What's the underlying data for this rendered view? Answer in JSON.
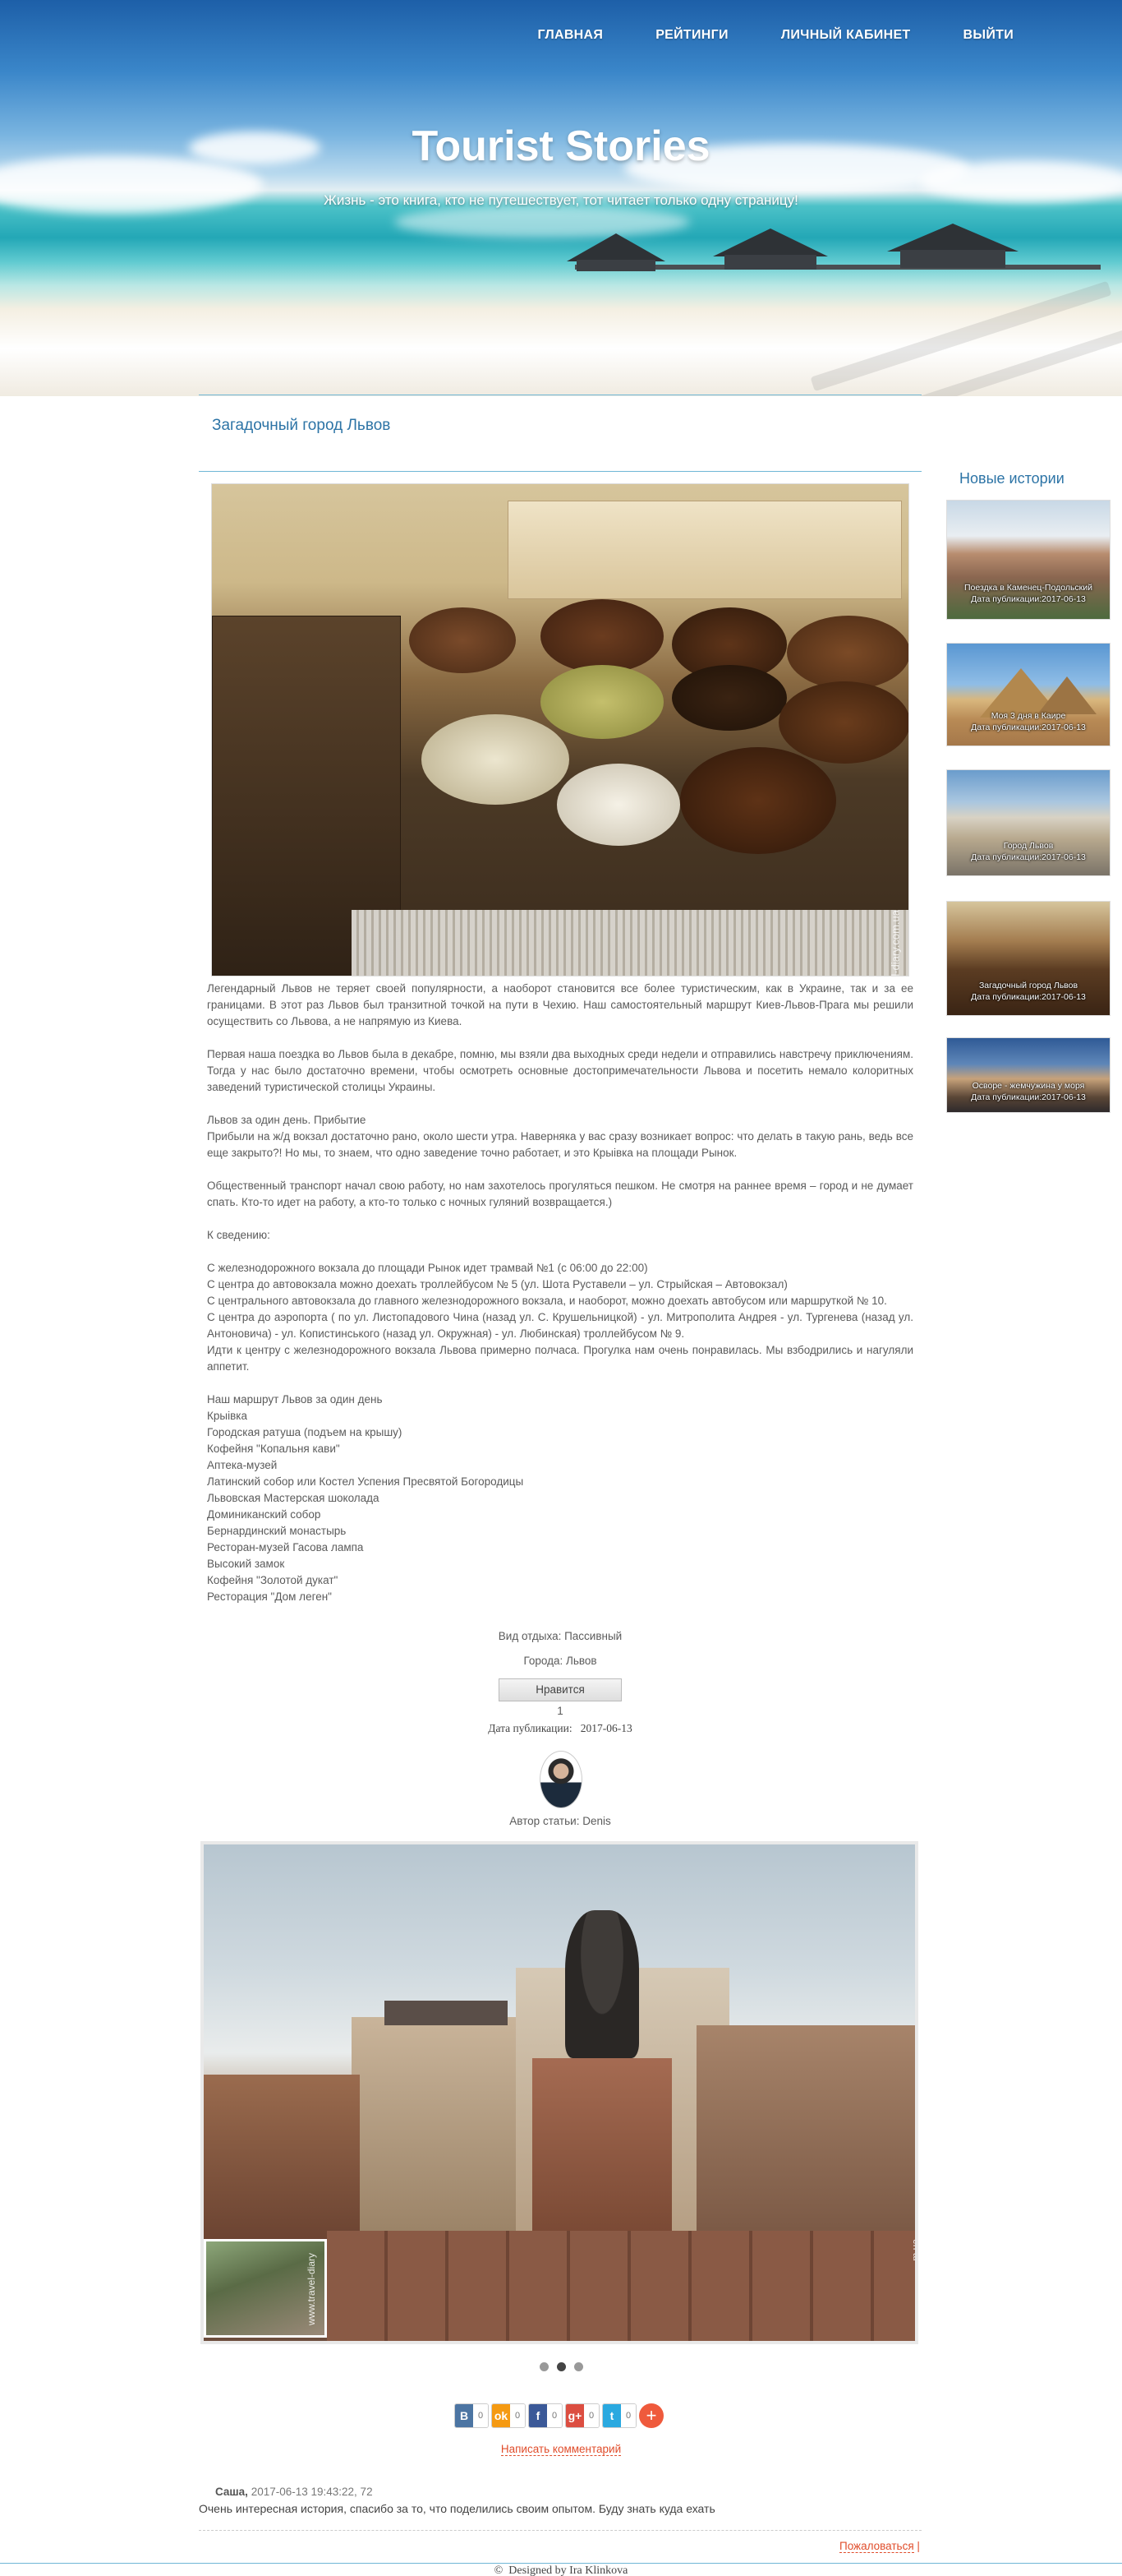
{
  "nav": {
    "items": [
      "ГЛАВНАЯ",
      "РЕЙТИНГИ",
      "ЛИЧНЫЙ КАБИНЕТ",
      "ВЫЙТИ"
    ]
  },
  "hero": {
    "title": "Tourist Stories",
    "tagline": "Жизнь - это книга, кто не путешествует, тот читает только одну страницу!"
  },
  "story": {
    "title": "Загадочный город Львов",
    "photo_watermark": "www.travel-diary.com.ua",
    "paragraphs": [
      "Легендарный Львов не теряет своей популярности, а наоборот становится все более туристическим, как в Украине, так и за ее границами. В этот раз Львов был транзитной точкой на пути в Чехию. Наш самостоятельный маршрут Киев-Львов-Прага мы решили осуществить со Львова, а не напрямую из Киева.",
      "",
      "Первая наша поездка во Львов была в декабре, помню, мы взяли два выходных среди недели и отправились навстречу приключениям. Тогда у нас было достаточно времени, чтобы осмотреть основные достопримечательности Львова и посетить немало колоритных заведений туристической столицы Украины.",
      "",
      "Львов за один день. Прибытие",
      "Прибыли на ж/д вокзал достаточно рано, около шести утра. Наверняка у вас сразу возникает вопрос: что делать в такую рань, ведь все еще закрыто?! Но мы, то знаем, что одно заведение точно работает, и это Крыівка на площади Рынок.",
      "",
      "Общественный транспорт начал свою работу, но нам захотелось прогуляться пешком. Не смотря на раннее время – город и не думает спать. Кто-то идет на работу, а кто-то только с ночных гуляний возвращается.)",
      "",
      "К сведению:",
      "",
      "С железнодорожного вокзала до площади Рынок идет трамвай №1 (с 06:00 до 22:00)",
      "С центра до автовокзала можно доехать троллейбусом № 5 (ул. Шота Руставели – ул. Стрыйская – Автовокзал)",
      "С центрального автовокзала до главного железнодорожного вокзала, и наоборот, можно доехать автобусом или маршруткой № 10.",
      "С центра до аэропорта ( по ул. Листопадового Чина (назад ул. С. Крушельницкой) - ул. Митрополита Андрея - ул. Тургенева (назад ул. Антоновича) - ул. Копистинського (назад ул. Окружная) - ул. Любинская) троллейбусом № 9.",
      "Идти к центру с железнодорожного вокзала Львова примерно полчаса. Прогулка нам очень понравилась. Мы взбодрились и нагуляли аппетит.",
      "",
      "Наш маршрут Львов за один день",
      "Крыівка",
      "Городская ратуша (подъем на крышу)",
      "Кофейня \"Копальня кави\"",
      "Аптека-музей",
      "Латинский собор или Костел Успения Пресвятой Богородицы",
      "Львовская Мастерская шоколада",
      "Доминиканский собор",
      "Бернардинский монастырь",
      "Ресторан-музей Гасова лампа",
      "Высокий замок",
      "Кофейня \"Золотой дукат\"",
      "Ресторация \"Дом леген\""
    ],
    "rest_type": "Вид отдыха: Пассивный",
    "city": "Города: Львов",
    "like_button": "Нравится",
    "like_count": "1",
    "date_label": "Дата публикации:",
    "date_value": "2017-06-13",
    "author": "Автор статьи: Denis"
  },
  "slider": {
    "watermark_left": "www.travel-diary",
    "watermark_right": "m.ua",
    "dots": 3,
    "active_dot": 1
  },
  "share": {
    "buttons": [
      {
        "icon": "В",
        "count": "0",
        "color": "#4c75a3"
      },
      {
        "icon": "ok",
        "count": "0",
        "color": "#f59a12"
      },
      {
        "icon": "f",
        "count": "0",
        "color": "#3b5998"
      },
      {
        "icon": "g+",
        "count": "0",
        "color": "#dc4e41"
      },
      {
        "icon": "t",
        "count": "0",
        "color": "#2aa9e0"
      }
    ],
    "more": "+"
  },
  "comments": {
    "write_link": "Написать комментарий",
    "items": [
      {
        "author": "Саша,",
        "meta": "2017-06-13 19:43:22, 72",
        "text": "Очень интересная история, спасибо за то, что поделились своим опытом. Буду знать куда ехать"
      }
    ],
    "complain_link": "Пожаловаться"
  },
  "footer": {
    "text": "Designed by Ira Klinkova"
  },
  "sidebar": {
    "title": "Новые истории",
    "stories": [
      {
        "title": "Поездка в Каменец-Подольский",
        "date": "Дата публикации:2017-06-13"
      },
      {
        "title": "Моя 3 дня в Каире",
        "date": "Дата публикации:2017-06-13"
      },
      {
        "title": "Город Львов",
        "date": "Дата публикации:2017-06-13"
      },
      {
        "title": "Загадочный город Львов",
        "date": "Дата публикации:2017-06-13"
      },
      {
        "title": "Осворе - жемчужина у моря",
        "date": "Дата публикации:2017-06-13"
      }
    ]
  },
  "colors": {
    "accent_blue": "#2d74a6",
    "accent_orange": "#e04d2b",
    "rule_blue": "#6fb7d6"
  }
}
